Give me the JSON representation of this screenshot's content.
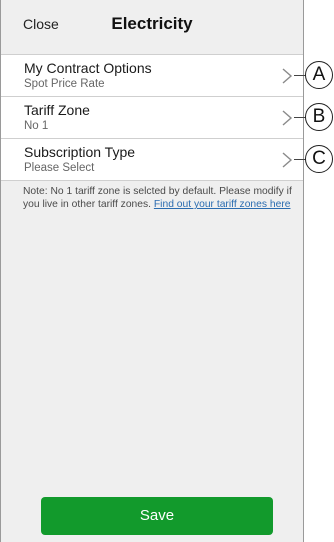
{
  "header": {
    "close_label": "Close",
    "title": "Electricity"
  },
  "settings": [
    {
      "title": "My Contract Options",
      "value": "Spot Price Rate",
      "callout": "A"
    },
    {
      "title": "Tariff Zone",
      "value": "No 1",
      "callout": "B"
    },
    {
      "title": "Subscription Type",
      "value": "Please Select",
      "callout": "C"
    }
  ],
  "note": {
    "text": "Note: No 1 tariff zone is selcted by default. Please modify if you live in other tariff zones. ",
    "link_text": "Find out your tariff zones here"
  },
  "footer": {
    "save_label": "Save"
  },
  "colors": {
    "save_button": "#129a2c",
    "link": "#2b6cb0",
    "background": "#efefef"
  }
}
